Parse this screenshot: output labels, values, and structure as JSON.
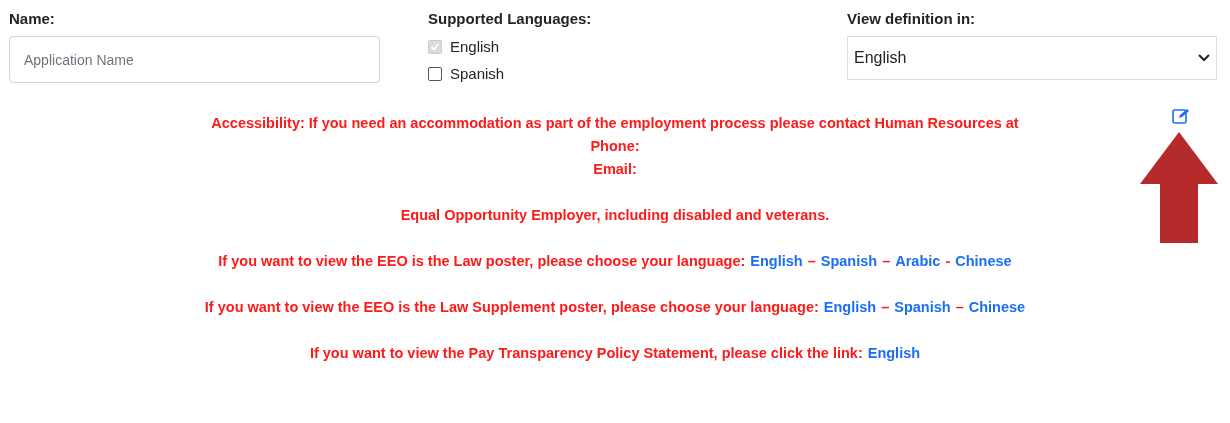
{
  "name_field": {
    "label": "Name:",
    "placeholder": "Application Name"
  },
  "supported_languages": {
    "label": "Supported Languages:",
    "options": [
      {
        "label": "English",
        "checked": true,
        "disabled": true
      },
      {
        "label": "Spanish",
        "checked": false,
        "disabled": false
      }
    ]
  },
  "view_definition": {
    "label": "View definition in:",
    "value": "English"
  },
  "notice": {
    "lines": [
      [
        {
          "kind": "text",
          "text": "Accessibility: If you need an accommodation as part of the employment process please contact Human Resources at"
        }
      ],
      [
        {
          "kind": "text",
          "text": "Phone:"
        }
      ],
      [
        {
          "kind": "text",
          "text": "Email:"
        }
      ],
      [
        {
          "kind": "gap"
        }
      ],
      [
        {
          "kind": "text",
          "text": "Equal Opportunity Employer, including disabled and veterans."
        }
      ],
      [
        {
          "kind": "gap"
        }
      ],
      [
        {
          "kind": "text",
          "text": "If you want to view the EEO is the Law poster, please choose your language:"
        },
        {
          "kind": "link",
          "text": "English"
        },
        {
          "kind": "sep",
          "text": "–"
        },
        {
          "kind": "link",
          "text": "Spanish"
        },
        {
          "kind": "sep",
          "text": "–"
        },
        {
          "kind": "link",
          "text": "Arabic"
        },
        {
          "kind": "sep",
          "text": "-"
        },
        {
          "kind": "link",
          "text": "Chinese"
        }
      ],
      [
        {
          "kind": "gap"
        }
      ],
      [
        {
          "kind": "text",
          "text": "If you want to view the EEO is the Law Supplement poster, please choose your language:"
        },
        {
          "kind": "link",
          "text": "English"
        },
        {
          "kind": "sep",
          "text": "–"
        },
        {
          "kind": "link",
          "text": "Spanish"
        },
        {
          "kind": "sep",
          "text": "–"
        },
        {
          "kind": "link",
          "text": "Chinese"
        }
      ],
      [
        {
          "kind": "gap"
        }
      ],
      [
        {
          "kind": "text",
          "text": "If you want to view the Pay Transparency Policy Statement, please click the link:"
        },
        {
          "kind": "link",
          "text": "English"
        }
      ]
    ]
  }
}
